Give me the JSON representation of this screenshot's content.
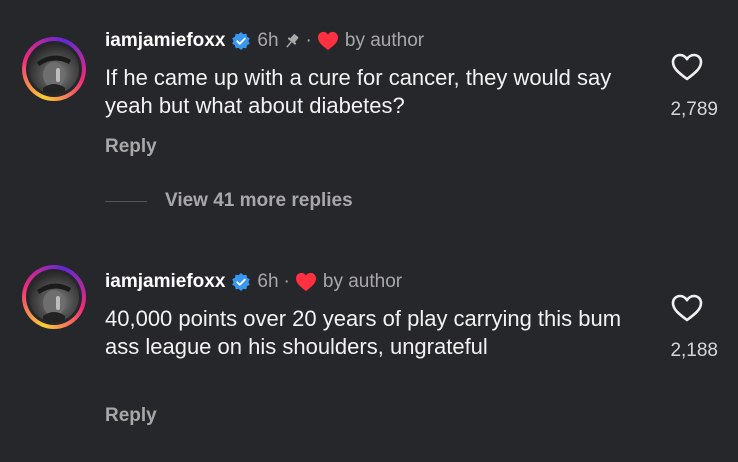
{
  "comments": [
    {
      "username": "iamjamiefoxx",
      "time": "6h",
      "dot": "·",
      "by_author": "by author",
      "text": "If he came up with a cure for cancer, they would say yeah but what about diabetes?",
      "reply_label": "Reply",
      "likes": "2,789",
      "pinned": true
    },
    {
      "username": "iamjamiefoxx",
      "time": "6h",
      "dot": "·",
      "by_author": "by author",
      "text": "40,000 points over 20 years of play carrying this bum ass league on his shoulders, ungrateful",
      "reply_label": "Reply",
      "likes": "2,188",
      "pinned": false
    }
  ],
  "view_more_label": "View 41 more replies",
  "icons": {
    "verified": "verified-badge-icon",
    "pin": "pin-icon",
    "author_heart": "red-heart-icon",
    "like": "heart-outline-icon"
  },
  "colors": {
    "background": "#26272b",
    "verified": "#3897f0",
    "author_heart": "#ff3040",
    "muted": "#a8a8a8"
  }
}
